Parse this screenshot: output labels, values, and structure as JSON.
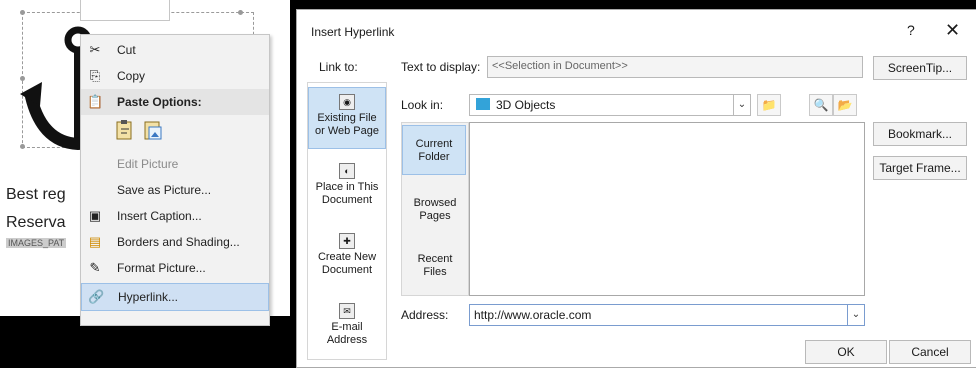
{
  "document": {
    "line1": "Best reg",
    "line2": "Reserva",
    "line3": "IMAGES_PAT"
  },
  "context_menu": {
    "items": [
      {
        "icon": "scissors-icon",
        "label": "Cut"
      },
      {
        "icon": "copy-icon",
        "label": "Copy"
      },
      {
        "icon": "clipboard-icon",
        "label": "Paste Options:"
      },
      {
        "label": "Edit Picture"
      },
      {
        "label": "Save as Picture..."
      },
      {
        "icon": "caption-icon",
        "label": "Insert Caption..."
      },
      {
        "icon": "borders-icon",
        "label": "Borders and Shading..."
      },
      {
        "icon": "format-picture-icon",
        "label": "Format Picture..."
      },
      {
        "icon": "hyperlink-icon",
        "label": "Hyperlink..."
      }
    ]
  },
  "dialog": {
    "title": "Insert Hyperlink",
    "help": "?",
    "close": "✕",
    "link_to_label": "Link to:",
    "link_to": [
      {
        "label1": "Existing File",
        "label2": "or Web Page",
        "icon": "web-page-icon"
      },
      {
        "label1": "Place in This",
        "label2": "Document",
        "icon": "place-in-document-icon"
      },
      {
        "label1": "Create New",
        "label2": "Document",
        "icon": "new-document-icon"
      },
      {
        "label1": "E-mail",
        "label2": "Address",
        "icon": "email-icon"
      }
    ],
    "text_to_display_label": "Text to display:",
    "text_to_display_value": "<<Selection in Document>>",
    "look_in_label": "Look in:",
    "look_in_value": "3D Objects",
    "subnav": [
      {
        "label1": "Current",
        "label2": "Folder"
      },
      {
        "label1": "Browsed",
        "label2": "Pages"
      },
      {
        "label1": "Recent",
        "label2": "Files"
      }
    ],
    "address_label": "Address:",
    "address_value": "http://www.oracle.com",
    "buttons": {
      "screentip": "ScreenTip...",
      "bookmark": "Bookmark...",
      "target_frame": "Target Frame...",
      "ok": "OK",
      "cancel": "Cancel"
    }
  }
}
